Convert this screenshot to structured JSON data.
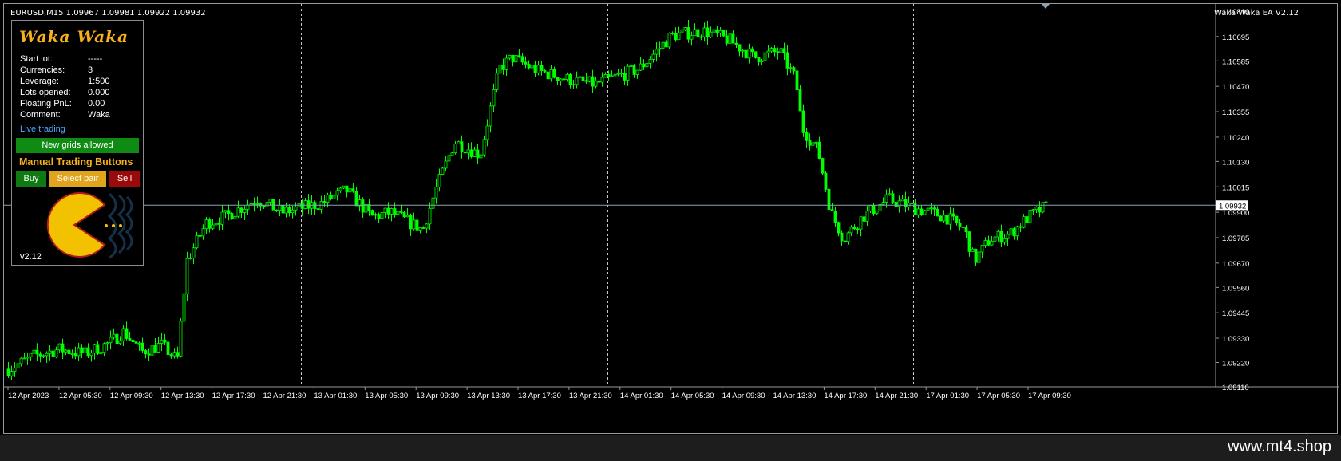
{
  "header": {
    "symbol_title": "EURUSD,M15  1.09967 1.09981 1.09922 1.09932",
    "ea_title": "Waka Waka EA  V2.12"
  },
  "panel": {
    "logo": "Waka Waka",
    "rows": [
      {
        "label": "Start lot:",
        "value": "-----"
      },
      {
        "label": "Currencies:",
        "value": "3"
      },
      {
        "label": "Leverage:",
        "value": "1:500"
      },
      {
        "label": "Lots opened:",
        "value": "0.000"
      },
      {
        "label": "Floating PnL:",
        "value": "0.00"
      },
      {
        "label": "Comment:",
        "value": "Waka"
      }
    ],
    "status": "Live trading",
    "grids_button": "New grids allowed",
    "manual_title": "Manual Trading Buttons",
    "buy_label": "Buy",
    "select_label": "Select pair",
    "sell_label": "Sell",
    "version": "v2.12",
    "colors": {
      "accent": "#f6b21b",
      "buy": "#0f7a12",
      "sell": "#9b0a0a",
      "select": "#e0a51c",
      "live": "#4ea7ff"
    }
  },
  "footer": {
    "url": "www.mt4.shop"
  },
  "chart_data": {
    "type": "candlestick",
    "symbol": "EURUSD",
    "timeframe": "M15",
    "current_price": "1.09932",
    "ylim": [
      1.0911,
      1.1081
    ],
    "y_ticks": [
      "1.10810",
      "1.10695",
      "1.10585",
      "1.10470",
      "1.10355",
      "1.10240",
      "1.10130",
      "1.10015",
      "1.09900",
      "1.09785",
      "1.09670",
      "1.09560",
      "1.09445",
      "1.09330",
      "1.09220",
      "1.09110"
    ],
    "x_ticks": [
      "12 Apr 2023",
      "12 Apr 05:30",
      "12 Apr 09:30",
      "12 Apr 13:30",
      "12 Apr 17:30",
      "12 Apr 21:30",
      "13 Apr 01:30",
      "13 Apr 05:30",
      "13 Apr 09:30",
      "13 Apr 13:30",
      "13 Apr 17:30",
      "13 Apr 21:30",
      "14 Apr 01:30",
      "14 Apr 05:30",
      "14 Apr 09:30",
      "14 Apr 13:30",
      "14 Apr 17:30",
      "14 Apr 21:30",
      "17 Apr 01:30",
      "17 Apr 05:30",
      "17 Apr 09:30"
    ],
    "day_separators": [
      "12 Apr 23:00",
      "13 Apr 23:00",
      "14 Apr 23:00",
      "17 Apr 23:00"
    ],
    "price_path": [
      {
        "t": "12 Apr 00:00",
        "p": 1.0919
      },
      {
        "t": "12 Apr 02:00",
        "p": 1.0925
      },
      {
        "t": "12 Apr 04:00",
        "p": 1.0928
      },
      {
        "t": "12 Apr 06:00",
        "p": 1.0926
      },
      {
        "t": "12 Apr 08:00",
        "p": 1.0931
      },
      {
        "t": "12 Apr 09:00",
        "p": 1.0936
      },
      {
        "t": "12 Apr 10:30",
        "p": 1.0927
      },
      {
        "t": "12 Apr 12:00",
        "p": 1.093
      },
      {
        "t": "12 Apr 13:15",
        "p": 1.0923
      },
      {
        "t": "12 Apr 14:00",
        "p": 1.0968
      },
      {
        "t": "12 Apr 15:30",
        "p": 1.0985
      },
      {
        "t": "12 Apr 17:00",
        "p": 1.0988
      },
      {
        "t": "12 Apr 19:30",
        "p": 1.0996
      },
      {
        "t": "12 Apr 21:30",
        "p": 1.099
      },
      {
        "t": "13 Apr 00:30",
        "p": 1.0994
      },
      {
        "t": "13 Apr 02:30",
        "p": 1.1
      },
      {
        "t": "13 Apr 04:30",
        "p": 1.0988
      },
      {
        "t": "13 Apr 06:00",
        "p": 1.099
      },
      {
        "t": "13 Apr 08:30",
        "p": 1.0982
      },
      {
        "t": "13 Apr 09:30",
        "p": 1.1
      },
      {
        "t": "13 Apr 11:00",
        "p": 1.1022
      },
      {
        "t": "13 Apr 13:00",
        "p": 1.1016
      },
      {
        "t": "13 Apr 14:30",
        "p": 1.1055
      },
      {
        "t": "13 Apr 15:30",
        "p": 1.106
      },
      {
        "t": "13 Apr 17:30",
        "p": 1.1054
      },
      {
        "t": "13 Apr 20:00",
        "p": 1.105
      },
      {
        "t": "13 Apr 22:00",
        "p": 1.1048
      },
      {
        "t": "14 Apr 01:30",
        "p": 1.1055
      },
      {
        "t": "14 Apr 04:00",
        "p": 1.107
      },
      {
        "t": "14 Apr 06:30",
        "p": 1.1072
      },
      {
        "t": "14 Apr 08:30",
        "p": 1.1068
      },
      {
        "t": "14 Apr 10:30",
        "p": 1.106
      },
      {
        "t": "14 Apr 12:30",
        "p": 1.1063
      },
      {
        "t": "14 Apr 13:45",
        "p": 1.105
      },
      {
        "t": "14 Apr 14:15",
        "p": 1.1028
      },
      {
        "t": "14 Apr 15:30",
        "p": 1.1018
      },
      {
        "t": "14 Apr 16:30",
        "p": 1.099
      },
      {
        "t": "14 Apr 17:30",
        "p": 1.0978
      },
      {
        "t": "14 Apr 19:00",
        "p": 1.0988
      },
      {
        "t": "14 Apr 21:00",
        "p": 1.0996
      },
      {
        "t": "14 Apr 23:00",
        "p": 1.0992
      },
      {
        "t": "17 Apr 01:30",
        "p": 1.0988
      },
      {
        "t": "17 Apr 03:00",
        "p": 1.0982
      },
      {
        "t": "17 Apr 03:45",
        "p": 1.0968
      },
      {
        "t": "17 Apr 05:00",
        "p": 1.0978
      },
      {
        "t": "17 Apr 06:30",
        "p": 1.098
      },
      {
        "t": "17 Apr 08:00",
        "p": 1.0988
      },
      {
        "t": "17 Apr 09:30",
        "p": 1.0993
      }
    ],
    "colors": {
      "candle": "#00ff00",
      "grid": "#c8c8c8",
      "bid_line": "#8aa3b8",
      "axis_text": "#ffffff"
    }
  }
}
